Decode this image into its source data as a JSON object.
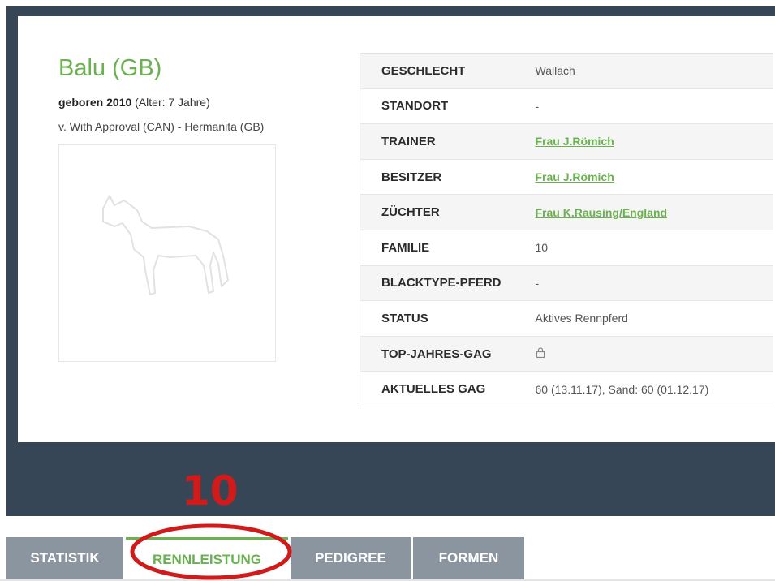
{
  "horse": {
    "name": "Balu (GB)",
    "born_bold": "geboren 2010",
    "age": " (Alter: 7 Jahre)",
    "pedigree": "v. With Approval (CAN) - Hermanita (GB)"
  },
  "info": [
    {
      "key": "GESCHLECHT",
      "value": "Wallach",
      "link": false
    },
    {
      "key": "STANDORT",
      "value": "-",
      "link": false
    },
    {
      "key": "TRAINER",
      "value": "Frau J.Römich",
      "link": true
    },
    {
      "key": "BESITZER",
      "value": "Frau J.Römich",
      "link": true
    },
    {
      "key": "ZÜCHTER",
      "value": "Frau K.Rausing/England",
      "link": true
    },
    {
      "key": "FAMILIE",
      "value": "10",
      "link": false
    },
    {
      "key": "BLACKTYPE-PFERD",
      "value": "-",
      "link": false
    },
    {
      "key": "STATUS",
      "value": "Aktives Rennpferd",
      "link": false
    },
    {
      "key": "TOP-JAHRES-GAG",
      "value": "",
      "icon": "lock-icon",
      "link": false
    },
    {
      "key": "AKTUELLES GAG",
      "value": "60 (13.11.17), Sand: 60 (01.12.17)",
      "link": false
    }
  ],
  "tabs": [
    {
      "label": "STATISTIK",
      "active": false
    },
    {
      "label": "RENNLEISTUNG",
      "active": true
    },
    {
      "label": "PEDIGREE",
      "active": false
    },
    {
      "label": "FORMEN",
      "active": false
    }
  ],
  "annotation": {
    "number": "10",
    "color": "#d11a1a"
  },
  "colors": {
    "accent": "#6ab24f",
    "dark": "#374656",
    "tab_inactive": "#8b95a0"
  }
}
